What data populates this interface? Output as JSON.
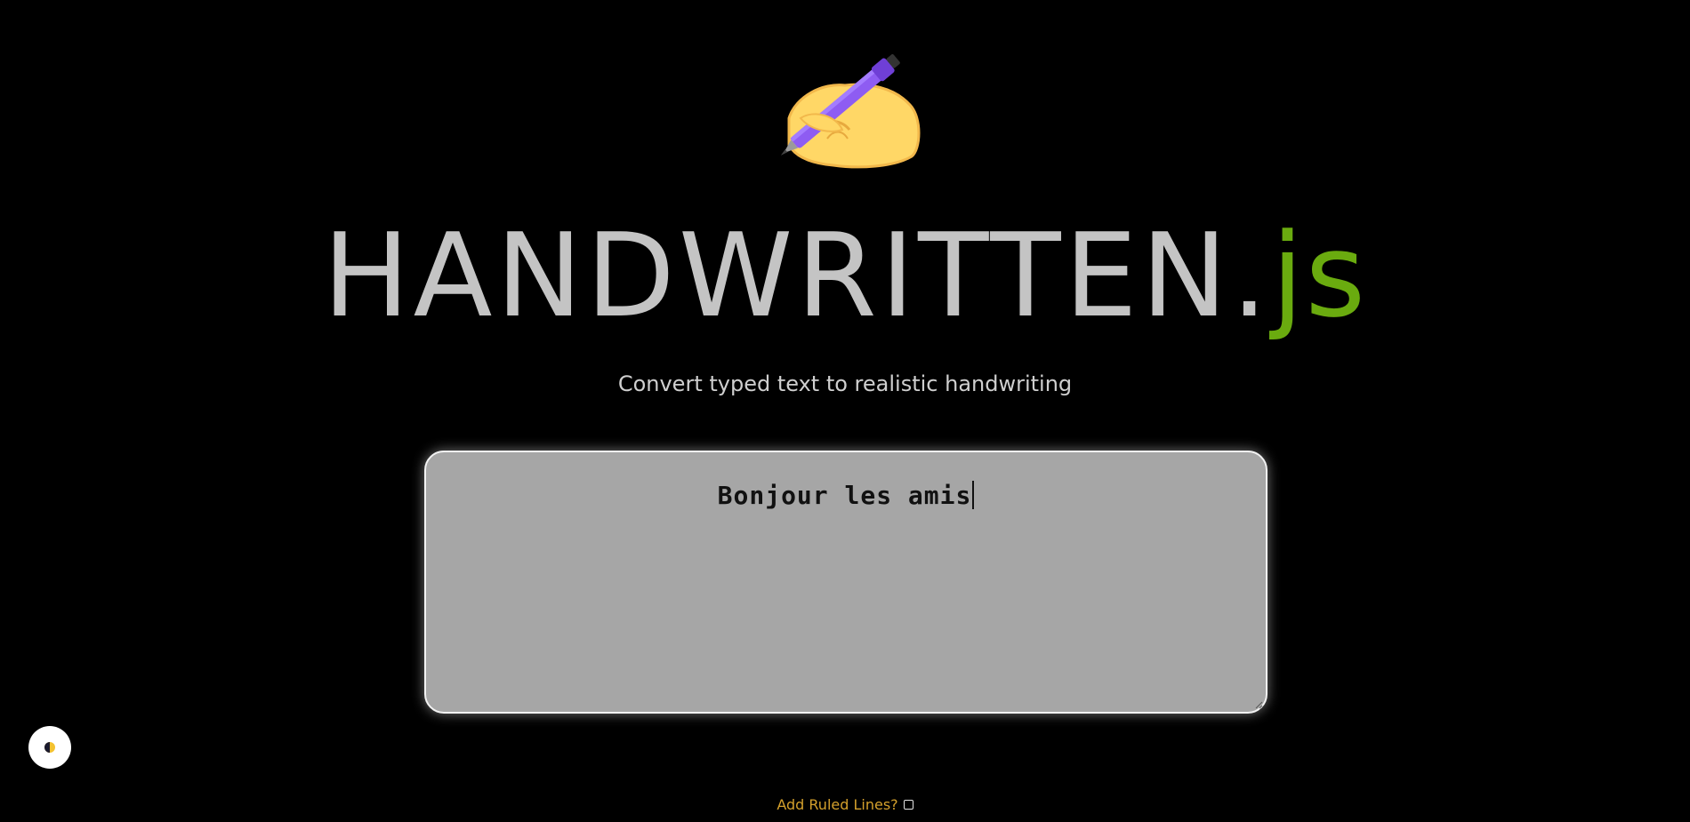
{
  "hero": {
    "icon": "writing-hand-icon"
  },
  "title": {
    "main": "HANDWRITTEN.",
    "suffix": "js"
  },
  "subtitle": "Convert typed text to realistic handwriting",
  "editor": {
    "value": "Bonjour les amis"
  },
  "theme_toggle": {
    "icon": "contrast-half-circle-icon"
  },
  "ruled_lines": {
    "label": "Add Ruled Lines?",
    "checked": false
  },
  "colors": {
    "background": "#000000",
    "title": "#c4c4c4",
    "accent_js": "#6aab0f",
    "editor_bg": "#a6a6a6",
    "ruled_label": "#d4a02c"
  }
}
